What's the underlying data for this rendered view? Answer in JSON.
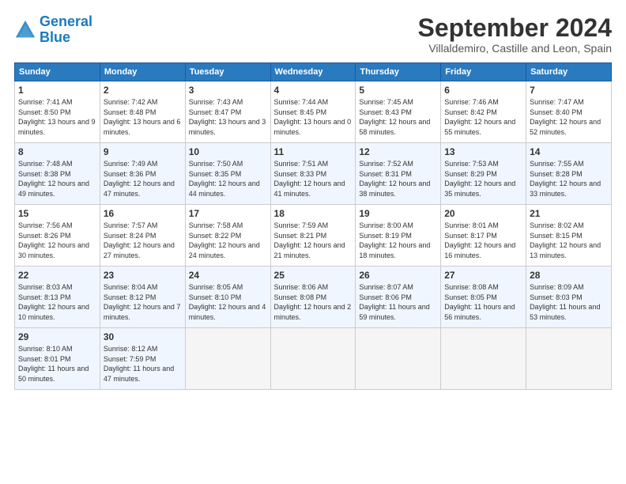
{
  "logo": {
    "line1": "General",
    "line2": "Blue"
  },
  "title": "September 2024",
  "subtitle": "Villaldemiro, Castille and Leon, Spain",
  "headers": [
    "Sunday",
    "Monday",
    "Tuesday",
    "Wednesday",
    "Thursday",
    "Friday",
    "Saturday"
  ],
  "weeks": [
    [
      {
        "day": "1",
        "rise": "Sunrise: 7:41 AM",
        "set": "Sunset: 8:50 PM",
        "daylight": "Daylight: 13 hours and 9 minutes."
      },
      {
        "day": "2",
        "rise": "Sunrise: 7:42 AM",
        "set": "Sunset: 8:48 PM",
        "daylight": "Daylight: 13 hours and 6 minutes."
      },
      {
        "day": "3",
        "rise": "Sunrise: 7:43 AM",
        "set": "Sunset: 8:47 PM",
        "daylight": "Daylight: 13 hours and 3 minutes."
      },
      {
        "day": "4",
        "rise": "Sunrise: 7:44 AM",
        "set": "Sunset: 8:45 PM",
        "daylight": "Daylight: 13 hours and 0 minutes."
      },
      {
        "day": "5",
        "rise": "Sunrise: 7:45 AM",
        "set": "Sunset: 8:43 PM",
        "daylight": "Daylight: 12 hours and 58 minutes."
      },
      {
        "day": "6",
        "rise": "Sunrise: 7:46 AM",
        "set": "Sunset: 8:42 PM",
        "daylight": "Daylight: 12 hours and 55 minutes."
      },
      {
        "day": "7",
        "rise": "Sunrise: 7:47 AM",
        "set": "Sunset: 8:40 PM",
        "daylight": "Daylight: 12 hours and 52 minutes."
      }
    ],
    [
      {
        "day": "8",
        "rise": "Sunrise: 7:48 AM",
        "set": "Sunset: 8:38 PM",
        "daylight": "Daylight: 12 hours and 49 minutes."
      },
      {
        "day": "9",
        "rise": "Sunrise: 7:49 AM",
        "set": "Sunset: 8:36 PM",
        "daylight": "Daylight: 12 hours and 47 minutes."
      },
      {
        "day": "10",
        "rise": "Sunrise: 7:50 AM",
        "set": "Sunset: 8:35 PM",
        "daylight": "Daylight: 12 hours and 44 minutes."
      },
      {
        "day": "11",
        "rise": "Sunrise: 7:51 AM",
        "set": "Sunset: 8:33 PM",
        "daylight": "Daylight: 12 hours and 41 minutes."
      },
      {
        "day": "12",
        "rise": "Sunrise: 7:52 AM",
        "set": "Sunset: 8:31 PM",
        "daylight": "Daylight: 12 hours and 38 minutes."
      },
      {
        "day": "13",
        "rise": "Sunrise: 7:53 AM",
        "set": "Sunset: 8:29 PM",
        "daylight": "Daylight: 12 hours and 35 minutes."
      },
      {
        "day": "14",
        "rise": "Sunrise: 7:55 AM",
        "set": "Sunset: 8:28 PM",
        "daylight": "Daylight: 12 hours and 33 minutes."
      }
    ],
    [
      {
        "day": "15",
        "rise": "Sunrise: 7:56 AM",
        "set": "Sunset: 8:26 PM",
        "daylight": "Daylight: 12 hours and 30 minutes."
      },
      {
        "day": "16",
        "rise": "Sunrise: 7:57 AM",
        "set": "Sunset: 8:24 PM",
        "daylight": "Daylight: 12 hours and 27 minutes."
      },
      {
        "day": "17",
        "rise": "Sunrise: 7:58 AM",
        "set": "Sunset: 8:22 PM",
        "daylight": "Daylight: 12 hours and 24 minutes."
      },
      {
        "day": "18",
        "rise": "Sunrise: 7:59 AM",
        "set": "Sunset: 8:21 PM",
        "daylight": "Daylight: 12 hours and 21 minutes."
      },
      {
        "day": "19",
        "rise": "Sunrise: 8:00 AM",
        "set": "Sunset: 8:19 PM",
        "daylight": "Daylight: 12 hours and 18 minutes."
      },
      {
        "day": "20",
        "rise": "Sunrise: 8:01 AM",
        "set": "Sunset: 8:17 PM",
        "daylight": "Daylight: 12 hours and 16 minutes."
      },
      {
        "day": "21",
        "rise": "Sunrise: 8:02 AM",
        "set": "Sunset: 8:15 PM",
        "daylight": "Daylight: 12 hours and 13 minutes."
      }
    ],
    [
      {
        "day": "22",
        "rise": "Sunrise: 8:03 AM",
        "set": "Sunset: 8:13 PM",
        "daylight": "Daylight: 12 hours and 10 minutes."
      },
      {
        "day": "23",
        "rise": "Sunrise: 8:04 AM",
        "set": "Sunset: 8:12 PM",
        "daylight": "Daylight: 12 hours and 7 minutes."
      },
      {
        "day": "24",
        "rise": "Sunrise: 8:05 AM",
        "set": "Sunset: 8:10 PM",
        "daylight": "Daylight: 12 hours and 4 minutes."
      },
      {
        "day": "25",
        "rise": "Sunrise: 8:06 AM",
        "set": "Sunset: 8:08 PM",
        "daylight": "Daylight: 12 hours and 2 minutes."
      },
      {
        "day": "26",
        "rise": "Sunrise: 8:07 AM",
        "set": "Sunset: 8:06 PM",
        "daylight": "Daylight: 11 hours and 59 minutes."
      },
      {
        "day": "27",
        "rise": "Sunrise: 8:08 AM",
        "set": "Sunset: 8:05 PM",
        "daylight": "Daylight: 11 hours and 56 minutes."
      },
      {
        "day": "28",
        "rise": "Sunrise: 8:09 AM",
        "set": "Sunset: 8:03 PM",
        "daylight": "Daylight: 11 hours and 53 minutes."
      }
    ],
    [
      {
        "day": "29",
        "rise": "Sunrise: 8:10 AM",
        "set": "Sunset: 8:01 PM",
        "daylight": "Daylight: 11 hours and 50 minutes."
      },
      {
        "day": "30",
        "rise": "Sunrise: 8:12 AM",
        "set": "Sunset: 7:59 PM",
        "daylight": "Daylight: 11 hours and 47 minutes."
      },
      {
        "day": "",
        "rise": "",
        "set": "",
        "daylight": ""
      },
      {
        "day": "",
        "rise": "",
        "set": "",
        "daylight": ""
      },
      {
        "day": "",
        "rise": "",
        "set": "",
        "daylight": ""
      },
      {
        "day": "",
        "rise": "",
        "set": "",
        "daylight": ""
      },
      {
        "day": "",
        "rise": "",
        "set": "",
        "daylight": ""
      }
    ]
  ]
}
